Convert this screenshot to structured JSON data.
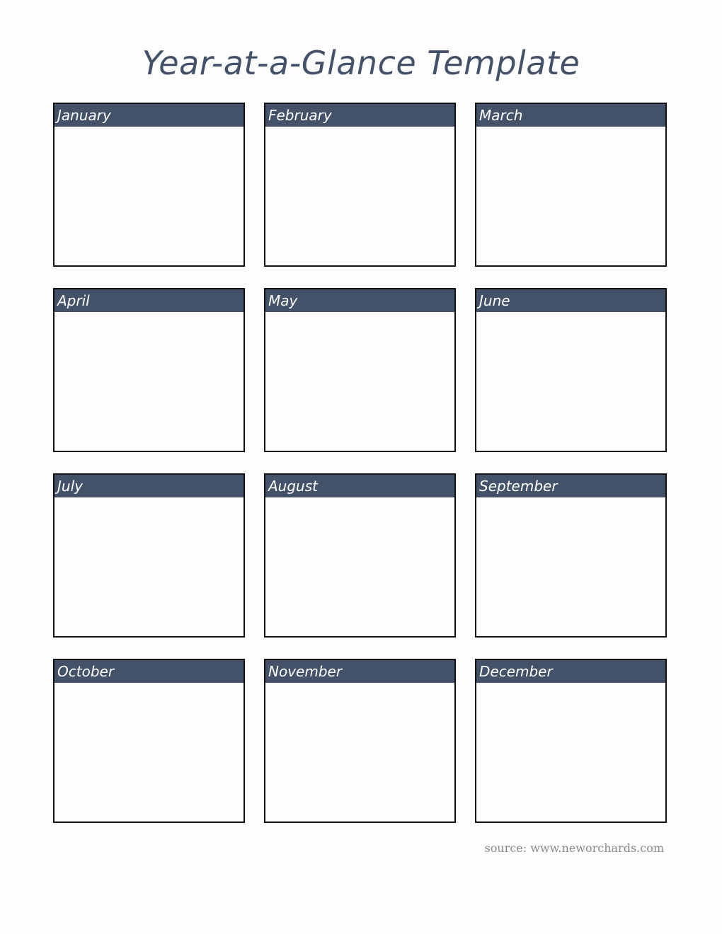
{
  "title": "Year-at-a-Glance Template",
  "colors": {
    "accent": "#435269",
    "border": "#111111",
    "source_text": "#8a8a8a"
  },
  "months": [
    {
      "label": "January",
      "notes": ""
    },
    {
      "label": "February",
      "notes": ""
    },
    {
      "label": "March",
      "notes": ""
    },
    {
      "label": "April",
      "notes": ""
    },
    {
      "label": "May",
      "notes": ""
    },
    {
      "label": "June",
      "notes": ""
    },
    {
      "label": "July",
      "notes": ""
    },
    {
      "label": "August",
      "notes": ""
    },
    {
      "label": "September",
      "notes": ""
    },
    {
      "label": "October",
      "notes": ""
    },
    {
      "label": "November",
      "notes": ""
    },
    {
      "label": "December",
      "notes": ""
    }
  ],
  "footer": {
    "source": "source: www.neworchards.com"
  }
}
